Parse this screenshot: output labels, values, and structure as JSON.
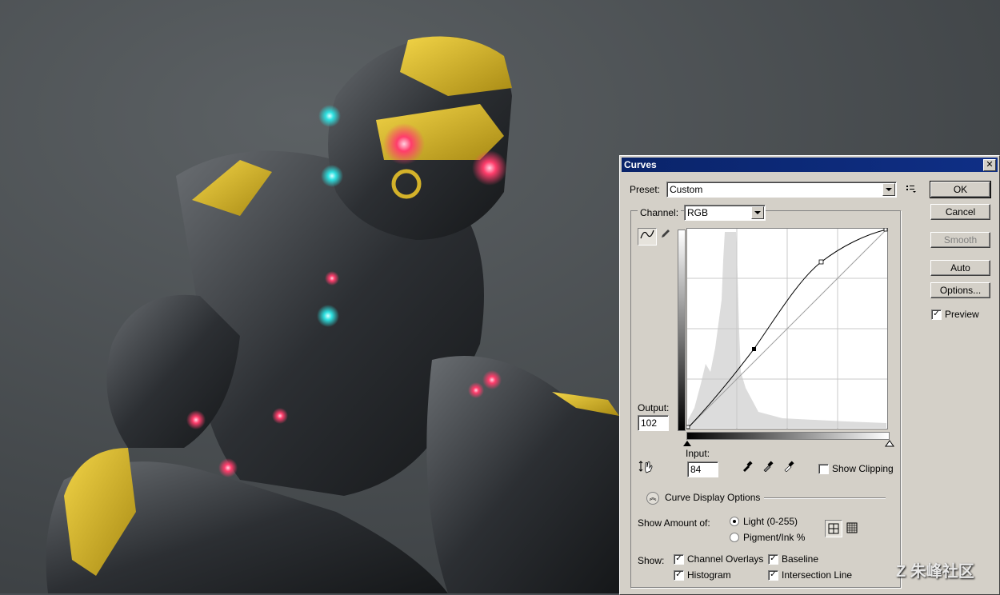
{
  "dialog": {
    "title": "Curves",
    "close_glyph": "✕",
    "preset_label": "Preset:",
    "preset_value": "Custom",
    "channel_label": "Channel:",
    "channel_value": "RGB",
    "output_label": "Output:",
    "output_value": "102",
    "input_label": "Input:",
    "input_value": "84",
    "show_clipping_label": "Show Clipping",
    "curve_display_options_label": "Curve Display Options",
    "show_amount_label": "Show Amount of:",
    "light_label": "Light  (0-255)",
    "pigment_label": "Pigment/Ink %",
    "show_label": "Show:",
    "channel_overlays_label": "Channel Overlays",
    "baseline_label": "Baseline",
    "histogram_label": "Histogram",
    "intersection_line_label": "Intersection Line",
    "buttons": {
      "ok": "OK",
      "cancel": "Cancel",
      "smooth": "Smooth",
      "auto": "Auto",
      "options": "Options..."
    },
    "preview_label": "Preview",
    "checks": {
      "preview": true,
      "show_clipping": false,
      "channel_overlays": true,
      "baseline": true,
      "histogram": true,
      "intersection_line": true
    },
    "light_selected": true,
    "curve_points_input_output": [
      [
        0,
        0
      ],
      [
        84,
        102
      ],
      [
        167,
        192
      ],
      [
        255,
        255
      ]
    ]
  },
  "watermark": "Z 朱峰社区",
  "icons": {
    "curve_tool": "curve-point-icon",
    "pencil_tool": "pencil-icon",
    "preset_menu": "preset-menu-icon",
    "on_image_adjust": "hand-adjust-icon",
    "black_eyedropper": "eyedropper-black-icon",
    "gray_eyedropper": "eyedropper-gray-icon",
    "white_eyedropper": "eyedropper-white-icon",
    "expand": "chevron-up-icon",
    "grid_small": "grid-4-icon",
    "grid_large": "grid-10-icon"
  }
}
